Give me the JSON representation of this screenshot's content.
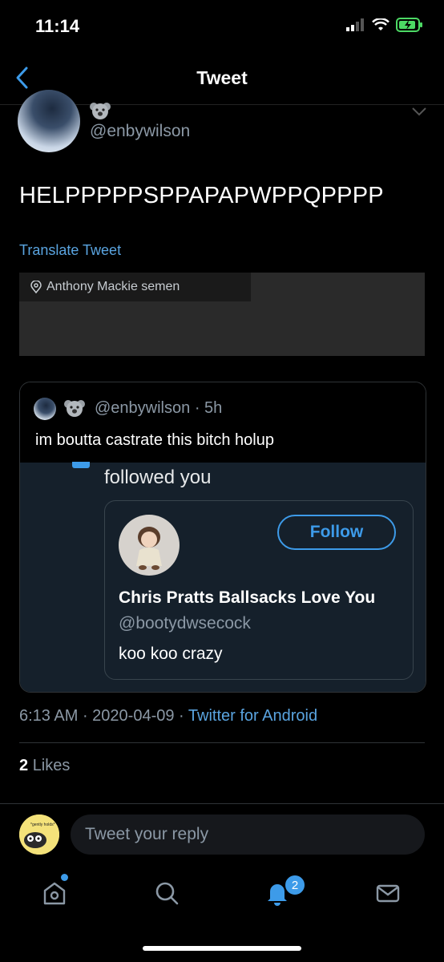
{
  "status": {
    "time": "11:14"
  },
  "header": {
    "title": "Tweet"
  },
  "tweet": {
    "handle": "@enbywilson",
    "text": "HELPPPPPSPPAPAPWPPQPPPP",
    "translate": "Translate Tweet",
    "location": "Anthony Mackie semen"
  },
  "quote": {
    "handle": "@enbywilson",
    "time": "· 5h",
    "text": "im boutta castrate this bitch holup",
    "notice": "followed you",
    "card": {
      "follow_label": "Follow",
      "name": "Chris Pratts Ballsacks Love You",
      "handle": "@bootydwsecock",
      "bio": "koo koo crazy"
    }
  },
  "meta": {
    "time": "6:13 AM",
    "date": "2020-04-09",
    "client": "Twitter for Android"
  },
  "likes": {
    "count": "2",
    "label": "Likes"
  },
  "reply": {
    "placeholder": "Tweet your reply",
    "avatar_caption": "*gently holds*"
  },
  "tabbar": {
    "notifications_badge": "2"
  },
  "colors": {
    "accent": "#3d9be9",
    "link": "#5aa4e0",
    "muted": "#8b98a5",
    "quote_bg": "#15202b"
  }
}
